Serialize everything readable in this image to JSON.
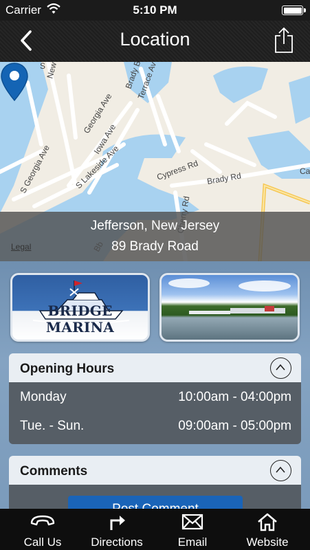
{
  "status_bar": {
    "carrier": "Carrier",
    "time": "5:10 PM"
  },
  "nav": {
    "title": "Location",
    "back_icon": "chevron-left-icon",
    "share_icon": "share-icon"
  },
  "map": {
    "legal": "Legal",
    "address_line1": "Jefferson, New Jersey",
    "address_line2": "89 Brady Road",
    "street_labels": [
      "S Georgia Ave",
      "Georgia Ave",
      "Iowa Ave",
      "S Lakeside Ave",
      "Brady Blvd",
      "Terrace Av",
      "Cypress Rd",
      "Brady Rd",
      "Cherry Rd",
      "New",
      "S",
      "Ca",
      "Bb"
    ]
  },
  "images": {
    "logo_text": "BRIDGE MARINA"
  },
  "opening_hours": {
    "title": "Opening Hours",
    "rows": [
      {
        "day": "Monday",
        "range": "10:00am - 04:00pm"
      },
      {
        "day": "Tue. - Sun.",
        "range": "09:00am - 05:00pm"
      }
    ]
  },
  "comments": {
    "title": "Comments",
    "post_button": "Post Comment"
  },
  "tabs": [
    {
      "label": "Call Us",
      "icon": "phone-icon"
    },
    {
      "label": "Directions",
      "icon": "directions-arrow-icon"
    },
    {
      "label": "Email",
      "icon": "envelope-icon"
    },
    {
      "label": "Website",
      "icon": "home-icon"
    }
  ],
  "colors": {
    "pin": "#1464b4",
    "nav_bg": "#222222",
    "panel_body": "#565e66",
    "button": "#1a64b8"
  }
}
